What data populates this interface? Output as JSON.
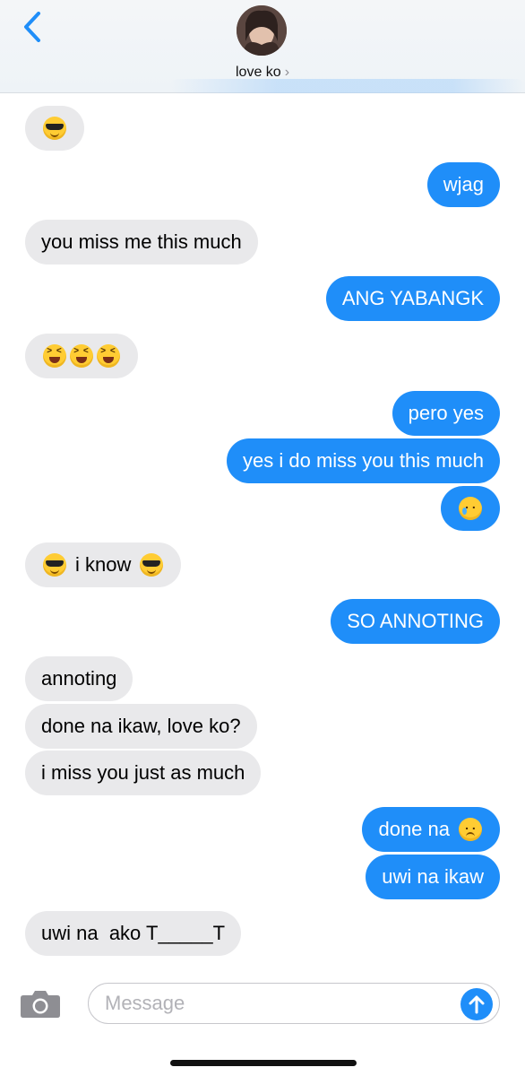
{
  "header": {
    "contact_name": "love ko",
    "chevron": "›"
  },
  "messages": [
    {
      "dir": "in",
      "text": "",
      "emoji": [
        "sunglasses-face"
      ]
    },
    {
      "dir": "out",
      "text": "wjag"
    },
    {
      "dir": "in",
      "text": "you miss me this much"
    },
    {
      "dir": "out",
      "text": "ANG YABANGK"
    },
    {
      "dir": "in",
      "text": "",
      "emoji": [
        "laughing-face",
        "laughing-face",
        "laughing-face"
      ]
    },
    {
      "dir": "out",
      "text": "pero yes"
    },
    {
      "dir": "out",
      "text": "yes i do miss you this much"
    },
    {
      "dir": "out",
      "text": "",
      "emoji": [
        "crying-face"
      ]
    },
    {
      "dir": "in",
      "text": "i know",
      "emoji_before": "sunglasses-face",
      "emoji_after": "sunglasses-face"
    },
    {
      "dir": "out",
      "text": "SO ANNOTING"
    },
    {
      "dir": "in",
      "text": "annoting"
    },
    {
      "dir": "in",
      "text": "done na ikaw, love ko?"
    },
    {
      "dir": "in",
      "text": "i miss you just as much"
    },
    {
      "dir": "out",
      "text": "done na",
      "emoji_after": "frowning-face"
    },
    {
      "dir": "out",
      "text": "uwi na ikaw"
    },
    {
      "dir": "in",
      "text": "uwi na  ako T_____T"
    }
  ],
  "input": {
    "placeholder": "Message"
  },
  "colors": {
    "outgoing_bubble": "#1f8ef9",
    "incoming_bubble": "#e9e9eb",
    "accent": "#1f8ef9"
  },
  "icons": {
    "back": "chevron-left-icon",
    "camera": "camera-icon",
    "send": "arrow-up-icon"
  }
}
